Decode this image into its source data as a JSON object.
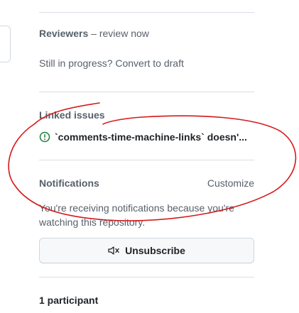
{
  "reviewers": {
    "label": "Reviewers",
    "separator": " – ",
    "action": "review now"
  },
  "draft": {
    "text": "Still in progress? Convert to draft"
  },
  "linked_issues": {
    "heading": "Linked issues",
    "items": [
      {
        "title": "`comments-time-machine-links` doesn'..."
      }
    ]
  },
  "notifications": {
    "heading": "Notifications",
    "customize_label": "Customize",
    "status_text": "You're receiving notifications because you're watching this repository.",
    "unsubscribe_label": "Unsubscribe"
  },
  "participants": {
    "text": "1 participant"
  },
  "colors": {
    "open_issue_green": "#1a7f37",
    "annotation_red": "#d3191c",
    "muted_text": "#57606a"
  },
  "icons": {
    "issue": "issue-opened-icon",
    "unsubscribe": "bell-slash-icon"
  }
}
